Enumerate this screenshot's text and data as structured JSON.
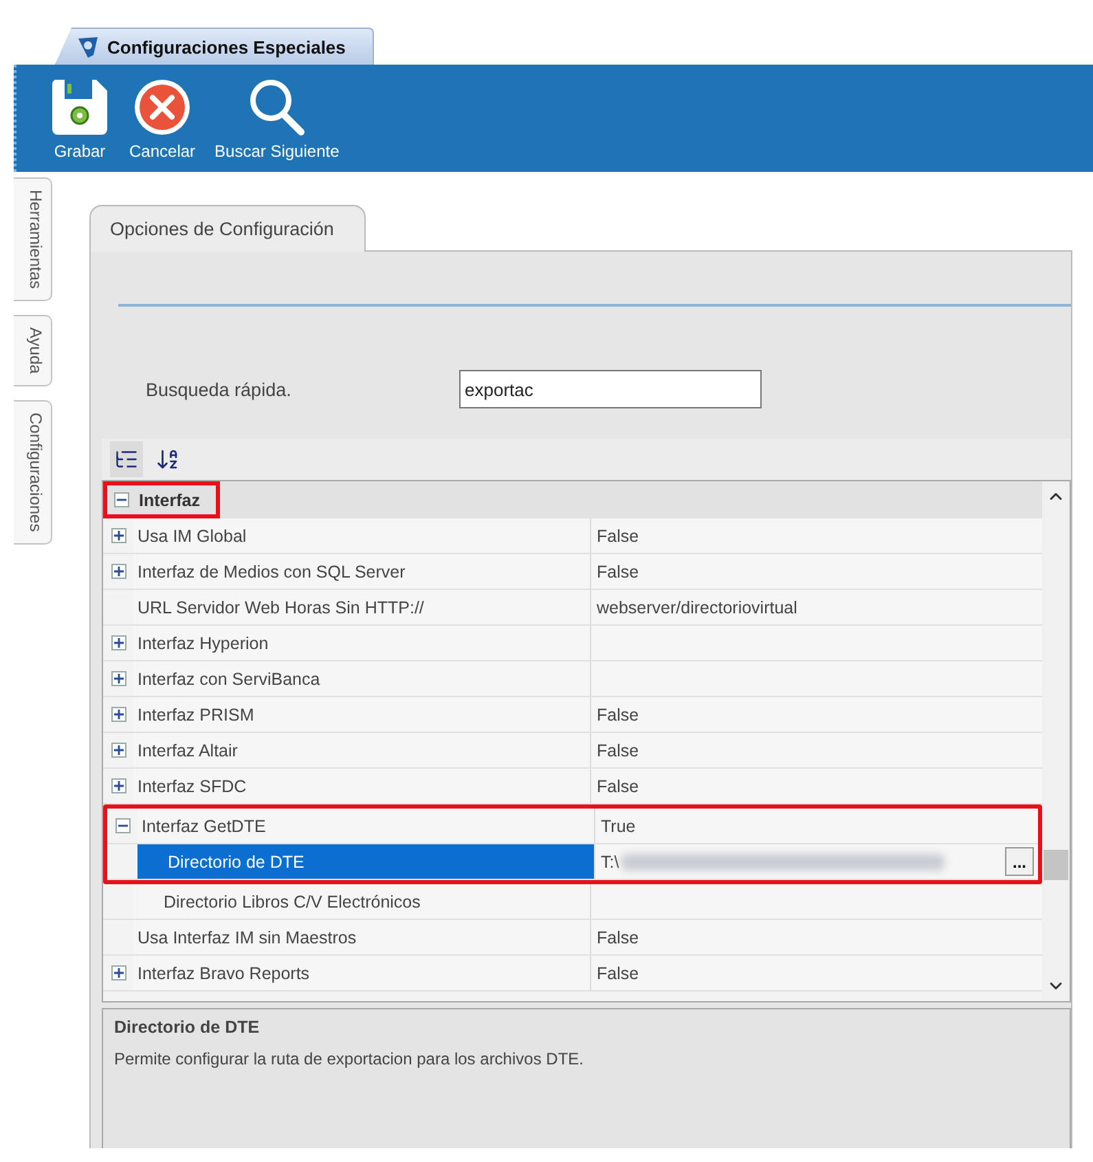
{
  "document_tab": {
    "title": "Configuraciones Especiales"
  },
  "toolbar": [
    {
      "label": "Grabar",
      "kind": "save"
    },
    {
      "label": "Cancelar",
      "kind": "cancel"
    },
    {
      "label": "Buscar Siguiente",
      "kind": "search"
    }
  ],
  "side_tabs": [
    {
      "label": "Herramientas"
    },
    {
      "label": "Ayuda"
    },
    {
      "label": "Configuraciones"
    }
  ],
  "panel_tab": {
    "title": "Opciones de Configuración"
  },
  "quick_search": {
    "label": "Busqueda rápida.",
    "value": "exportac"
  },
  "property_grid": {
    "categories": [
      {
        "name": "Interfaz",
        "expanded": true,
        "highlighted": true,
        "rows": [
          {
            "name": "Usa IM Global",
            "value": "False",
            "kind": "expandable",
            "expanded": false,
            "selected": false,
            "highlighted": false
          },
          {
            "name": "Interfaz de Medios con SQL Server",
            "value": "False",
            "kind": "expandable",
            "expanded": false,
            "selected": false,
            "highlighted": false
          },
          {
            "name": "URL Servidor Web Horas Sin HTTP://",
            "value": "webserver/directoriovirtual",
            "kind": "plain",
            "selected": false,
            "highlighted": false
          },
          {
            "name": "Interfaz Hyperion",
            "kind": "expandable",
            "expanded": false,
            "selected": false,
            "highlighted": false
          },
          {
            "name": "Interfaz con ServiBanca",
            "kind": "expandable",
            "expanded": false,
            "selected": false,
            "highlighted": false
          },
          {
            "name": "Interfaz PRISM",
            "value": "False",
            "kind": "expandable",
            "expanded": false,
            "selected": false,
            "highlighted": false
          },
          {
            "name": "Interfaz Altair",
            "value": "False",
            "kind": "expandable",
            "expanded": false,
            "selected": false,
            "highlighted": false
          },
          {
            "name": "Interfaz SFDC",
            "value": "False",
            "kind": "expandable",
            "expanded": false,
            "selected": false,
            "highlighted": false
          },
          {
            "name": "Interfaz GetDTE",
            "value": "True",
            "kind": "expandable",
            "expanded": true,
            "selected": false,
            "highlighted": true,
            "children": [
              {
                "name": "Directorio de DTE",
                "value": "T:\\",
                "redacted": true,
                "button": "...",
                "kind": "plain",
                "selected": true,
                "highlighted": true
              },
              {
                "name": "Directorio Libros C/V Electrónicos",
                "kind": "plain",
                "selected": false,
                "highlighted": false
              }
            ]
          },
          {
            "name": "Usa Interfaz IM sin Maestros",
            "value": "False",
            "kind": "plain",
            "selected": false,
            "highlighted": false
          },
          {
            "name": "Interfaz Bravo Reports",
            "value": "False",
            "kind": "expandable",
            "expanded": false,
            "selected": false,
            "highlighted": false
          }
        ]
      }
    ]
  },
  "description": {
    "title": "Directorio de DTE",
    "text": "Permite configurar la ruta de exportacion para los archivos DTE."
  }
}
